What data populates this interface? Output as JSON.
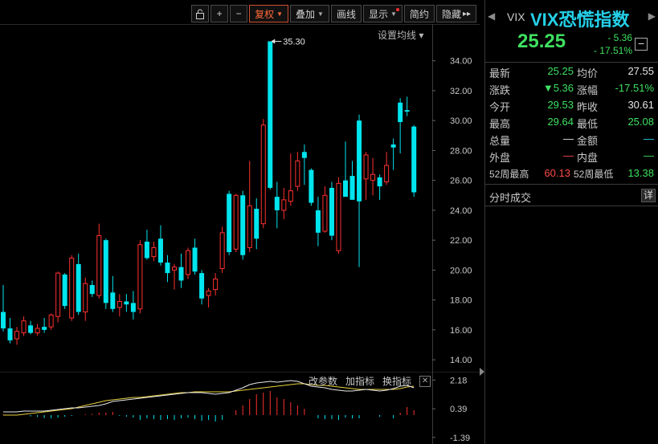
{
  "toolbar": {
    "lock_icon": "lock-icon",
    "plus": "+",
    "minus": "−",
    "restore": "复权",
    "overlay": "叠加",
    "draw": "画线",
    "display": "显示",
    "brief": "简约",
    "hide": "隐藏",
    "more": "▸▸"
  },
  "ma_setting": "设置均线 ▾",
  "peak_annotation": "35.30",
  "indicator_toolbar": {
    "modify": "改参数",
    "add": "加指标",
    "switch": "换指标",
    "close": "✕"
  },
  "colors": {
    "up": "#ff3030",
    "down": "#00e5ee",
    "ma1": "#e8e8e8",
    "ma2": "#e8d040",
    "accent_title": "#25d0e8",
    "green_value": "#3fe060"
  },
  "chart_data": {
    "type": "candlestick",
    "price_axis": {
      "ticks": [
        "34.00",
        "32.00",
        "30.00",
        "28.00",
        "26.00",
        "24.00",
        "22.00",
        "20.00",
        "18.00",
        "16.00",
        "14.00"
      ],
      "ylim": [
        13.2,
        36.4
      ]
    },
    "indicator_axis": {
      "ticks": [
        "2.18",
        "0.39",
        "-1.39"
      ],
      "ylim": [
        -1.8,
        2.7
      ]
    },
    "candles": [
      [
        17.2,
        19.0,
        15.9,
        16.1
      ],
      [
        16.1,
        16.8,
        15.1,
        15.3
      ],
      [
        15.4,
        16.2,
        15.0,
        15.9
      ],
      [
        15.8,
        16.9,
        15.6,
        16.6
      ],
      [
        16.3,
        16.6,
        15.7,
        15.8
      ],
      [
        15.8,
        16.4,
        15.6,
        16.1
      ],
      [
        16.2,
        16.8,
        15.8,
        16.0
      ],
      [
        16.2,
        17.1,
        16.0,
        17.0
      ],
      [
        16.9,
        19.9,
        16.5,
        19.8
      ],
      [
        19.7,
        19.8,
        17.4,
        17.6
      ],
      [
        16.8,
        21.0,
        16.6,
        20.8
      ],
      [
        20.4,
        21.1,
        17.0,
        17.2
      ],
      [
        17.2,
        19.5,
        16.6,
        19.1
      ],
      [
        19.0,
        19.3,
        18.2,
        18.4
      ],
      [
        18.3,
        23.1,
        18.1,
        22.3
      ],
      [
        22.0,
        22.1,
        17.4,
        17.8
      ],
      [
        18.5,
        19.6,
        17.2,
        17.4
      ],
      [
        17.5,
        18.4,
        16.9,
        17.9
      ],
      [
        17.9,
        18.4,
        17.2,
        17.7
      ],
      [
        17.8,
        18.6,
        16.7,
        17.2
      ],
      [
        17.4,
        22.0,
        17.1,
        21.7
      ],
      [
        21.9,
        22.7,
        20.7,
        20.8
      ],
      [
        20.9,
        21.9,
        20.6,
        21.5
      ],
      [
        22.1,
        23.0,
        20.3,
        20.5
      ],
      [
        20.5,
        21.0,
        19.2,
        19.8
      ],
      [
        20.0,
        20.4,
        18.7,
        20.2
      ],
      [
        20.2,
        21.1,
        18.8,
        19.3
      ],
      [
        19.7,
        21.5,
        19.4,
        21.3
      ],
      [
        21.5,
        22.1,
        19.7,
        19.9
      ],
      [
        19.8,
        20.0,
        17.7,
        18.1
      ],
      [
        18.3,
        18.8,
        17.5,
        18.6
      ],
      [
        18.7,
        19.8,
        18.3,
        19.4
      ],
      [
        20.1,
        22.9,
        19.8,
        22.5
      ],
      [
        25.1,
        25.3,
        21.0,
        21.2
      ],
      [
        21.4,
        25.1,
        21.2,
        25.0
      ],
      [
        25.0,
        25.3,
        20.7,
        21.0
      ],
      [
        21.5,
        27.3,
        21.2,
        24.3
      ],
      [
        24.1,
        24.8,
        21.4,
        22.1
      ],
      [
        23.1,
        30.1,
        22.8,
        29.7
      ],
      [
        35.3,
        35.3,
        25.4,
        25.5
      ],
      [
        24.9,
        25.9,
        22.8,
        24.0
      ],
      [
        24.0,
        25.5,
        23.4,
        24.7
      ],
      [
        24.6,
        27.8,
        24.3,
        25.3
      ],
      [
        25.6,
        27.9,
        25.3,
        27.3
      ],
      [
        27.9,
        28.4,
        25.7,
        27.5
      ],
      [
        26.7,
        26.8,
        24.3,
        24.5
      ],
      [
        24.0,
        24.9,
        21.6,
        22.5
      ],
      [
        22.6,
        25.6,
        22.5,
        25.0
      ],
      [
        25.5,
        25.9,
        22.0,
        22.3
      ],
      [
        21.3,
        26.2,
        21.1,
        25.8
      ],
      [
        26.0,
        28.6,
        25.2,
        24.9
      ],
      [
        26.3,
        27.3,
        25.5,
        24.7
      ],
      [
        30.0,
        30.4,
        20.2,
        24.6
      ],
      [
        26.1,
        27.9,
        24.7,
        27.7
      ],
      [
        26.0,
        27.5,
        25.0,
        26.4
      ],
      [
        26.2,
        26.4,
        24.7,
        25.6
      ],
      [
        25.9,
        27.9,
        25.7,
        27.0
      ],
      [
        28.4,
        28.8,
        26.7,
        28.2
      ],
      [
        31.2,
        31.5,
        27.8,
        29.9
      ],
      [
        30.7,
        31.6,
        30.3,
        30.6
      ],
      [
        29.6,
        29.7,
        24.9,
        25.2
      ]
    ],
    "ma1": [
      0.2,
      0.2,
      0.2,
      0.25,
      0.25,
      0.25,
      0.25,
      0.3,
      0.35,
      0.4,
      0.45,
      0.45,
      0.5,
      0.55,
      0.6,
      0.7,
      0.85,
      0.9,
      0.95,
      1.0,
      1.05,
      1.1,
      1.15,
      1.2,
      1.25,
      1.3,
      1.35,
      1.4,
      1.4,
      1.4,
      1.35,
      1.3,
      1.35,
      1.4,
      1.55,
      1.7,
      1.9,
      2.0,
      2.05,
      2.1,
      2.05,
      2.1,
      2.15,
      2.1,
      1.95,
      1.8,
      1.75,
      1.7,
      1.6,
      1.55,
      1.5,
      1.5,
      1.55,
      1.6,
      1.55,
      1.5,
      1.55,
      1.65,
      1.8,
      1.85,
      1.7
    ],
    "ma2": [
      0.0,
      0.0,
      0.0,
      0.05,
      0.1,
      0.15,
      0.2,
      0.25,
      0.3,
      0.35,
      0.4,
      0.5,
      0.6,
      0.7,
      0.8,
      0.9,
      0.95,
      1.0,
      1.05,
      1.1,
      1.1,
      1.15,
      1.2,
      1.25,
      1.3,
      1.35,
      1.4,
      1.4,
      1.45,
      1.45,
      1.45,
      1.45,
      1.45,
      1.45,
      1.5,
      1.55,
      1.6,
      1.65,
      1.7,
      1.75,
      1.8,
      1.85,
      1.9,
      1.95,
      1.95,
      1.9,
      1.85,
      1.85,
      1.8,
      1.75,
      1.7,
      1.65,
      1.6,
      1.6,
      1.6,
      1.6,
      1.6,
      1.6,
      1.65,
      1.75,
      1.8
    ],
    "histogram": [
      0.05,
      0.03,
      0.02,
      0.0,
      -0.08,
      -0.12,
      -0.18,
      -0.2,
      -0.15,
      -0.1,
      -0.05,
      0.0,
      0.05,
      0.08,
      0.15,
      0.15,
      0.2,
      -0.05,
      -0.1,
      -0.15,
      -0.3,
      -0.2,
      -0.25,
      -0.3,
      -0.25,
      -0.3,
      -0.2,
      -0.15,
      -0.25,
      -0.35,
      -0.3,
      -0.4,
      -0.3,
      0.0,
      0.3,
      0.6,
      1.0,
      1.3,
      1.4,
      1.5,
      1.1,
      1.0,
      0.8,
      0.6,
      0.4,
      0.0,
      -0.2,
      -0.25,
      -0.25,
      -0.3,
      -0.15,
      -0.2,
      -0.2,
      0.0,
      0.0,
      -0.1,
      0.0,
      -0.2,
      0.15,
      0.5,
      0.3
    ]
  },
  "panel": {
    "nav_left": "◀",
    "nav_right": "▶",
    "symbol": "VIX",
    "title": "VIX恐慌指数",
    "price": "25.25",
    "change": "- 5.36",
    "change_pct": "- 17.51%",
    "collapse": "−",
    "stats": {
      "latest_label": "最新",
      "latest": "25.25",
      "avg_label": "均价",
      "avg": "27.55",
      "chg_label": "涨跌",
      "chg": "▼5.36",
      "chgpct_label": "涨幅",
      "chgpct": "-17.51%",
      "open_label": "今开",
      "open": "29.53",
      "prev_label": "昨收",
      "prev": "30.61",
      "high_label": "最高",
      "high": "29.64",
      "low_label": "最低",
      "low": "25.08",
      "vol_label": "总量",
      "vol": "—",
      "amt_label": "金额",
      "amt": "—",
      "outer_label": "外盘",
      "outer": "—",
      "inner_label": "内盘",
      "inner": "—",
      "wk52h_label": "52周最高",
      "wk52h": "60.13",
      "wk52l_label": "52周最低",
      "wk52l": "13.38"
    },
    "ticks_title": "分时成交",
    "detail": "详"
  }
}
